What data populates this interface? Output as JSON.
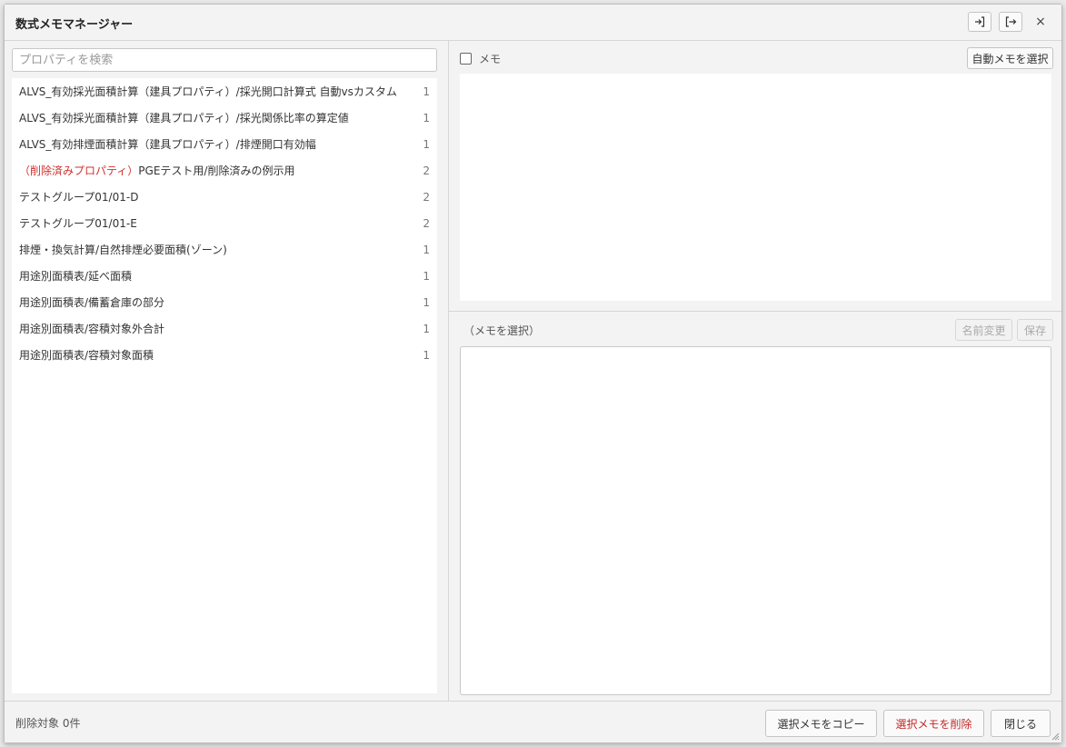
{
  "window": {
    "title": "数式メモマネージャー",
    "close_glyph": "×"
  },
  "search": {
    "placeholder": "プロパティを検索",
    "value": ""
  },
  "properties": [
    {
      "prefix": "",
      "label": "ALVS_有効採光面積計算（建具プロパティ）/採光開口計算式 自動vsカスタム",
      "count": "1"
    },
    {
      "prefix": "",
      "label": "ALVS_有効採光面積計算（建具プロパティ）/採光関係比率の算定値",
      "count": "1"
    },
    {
      "prefix": "",
      "label": "ALVS_有効排煙面積計算（建具プロパティ）/排煙開口有効幅",
      "count": "1"
    },
    {
      "prefix": "（削除済みプロパティ）",
      "label": "PGEテスト用/削除済みの例示用",
      "count": "2"
    },
    {
      "prefix": "",
      "label": "テストグループ01/01-D",
      "count": "2"
    },
    {
      "prefix": "",
      "label": "テストグループ01/01-E",
      "count": "2"
    },
    {
      "prefix": "",
      "label": "排煙・換気計算/自然排煙必要面積(ゾーン)",
      "count": "1"
    },
    {
      "prefix": "",
      "label": "用途別面積表/延べ面積",
      "count": "1"
    },
    {
      "prefix": "",
      "label": "用途別面積表/備蓄倉庫の部分",
      "count": "1"
    },
    {
      "prefix": "",
      "label": "用途別面積表/容積対象外合計",
      "count": "1"
    },
    {
      "prefix": "",
      "label": "用途別面積表/容積対象面積",
      "count": "1"
    }
  ],
  "memo": {
    "checkbox_label": "メモ",
    "auto_select_button": "自動メモを選択",
    "selected_label": "（メモを選択）",
    "rename_button": "名前変更",
    "save_button": "保存",
    "editor_value": ""
  },
  "footer": {
    "status": "削除対象 0件",
    "copy_button": "選択メモをコピー",
    "delete_button": "選択メモを削除",
    "close_button": "閉じる"
  },
  "colors": {
    "deleted_text": "#d0312d",
    "danger_button_text": "#c62828"
  }
}
